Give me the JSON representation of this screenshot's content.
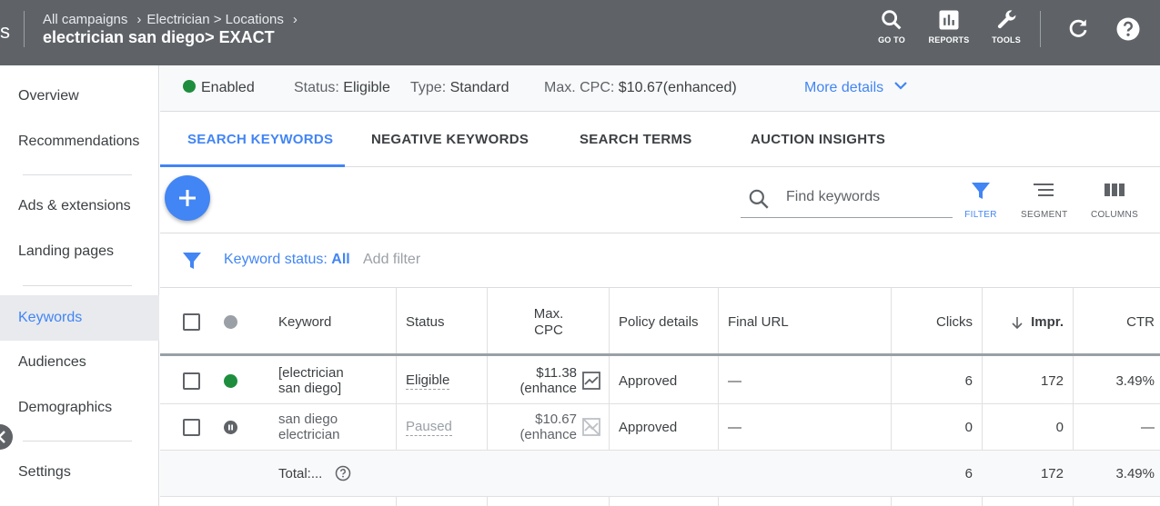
{
  "header": {
    "logo_fragment": "s",
    "breadcrumbs": [
      "All campaigns",
      "Electrician > Locations"
    ],
    "title": "electrician san diego> EXACT",
    "tools": [
      {
        "label": "GO TO",
        "icon": "search-icon"
      },
      {
        "label": "REPORTS",
        "icon": "bar-chart-icon"
      },
      {
        "label": "TOOLS",
        "icon": "wrench-icon"
      }
    ]
  },
  "sidebar": {
    "items": [
      {
        "label": "Overview"
      },
      {
        "label": "Recommendations"
      },
      {
        "label": "Ads & extensions"
      },
      {
        "label": "Landing pages"
      },
      {
        "label": "Keywords",
        "active": true
      },
      {
        "label": "Audiences"
      },
      {
        "label": "Demographics"
      },
      {
        "label": "Settings"
      }
    ]
  },
  "statusbar": {
    "enabled": "Enabled",
    "status_label": "Status:",
    "status_value": "Eligible",
    "type_label": "Type:",
    "type_value": "Standard",
    "maxcpc_label": "Max. CPC:",
    "maxcpc_value": "$10.67(enhanced)",
    "more_details": "More details"
  },
  "tabs": [
    "SEARCH KEYWORDS",
    "NEGATIVE KEYWORDS",
    "SEARCH TERMS",
    "AUCTION INSIGHTS"
  ],
  "toolbar": {
    "search_placeholder": "Find keywords",
    "filter_label": "FILTER",
    "segment_label": "SEGMENT",
    "columns_label": "COLUMNS"
  },
  "filter": {
    "label": "Keyword status:",
    "value": "All",
    "add_filter": "Add filter"
  },
  "table": {
    "headers": {
      "keyword": "Keyword",
      "status": "Status",
      "max_cpc_line1": "Max.",
      "max_cpc_line2": "CPC",
      "policy": "Policy details",
      "final_url": "Final URL",
      "clicks": "Clicks",
      "impr": "Impr.",
      "ctr": "CTR"
    },
    "rows": [
      {
        "keyword_line1": "[electrician",
        "keyword_line2": "san diego]",
        "status": "Eligible",
        "cpc_line1": "$11.38",
        "cpc_line2": "(enhance",
        "policy": "Approved",
        "final_url": "—",
        "clicks": "6",
        "impr": "172",
        "ctr": "3.49%"
      },
      {
        "keyword_line1": "san diego",
        "keyword_line2": "electrician",
        "status": "Paused",
        "cpc_line1": "$10.67",
        "cpc_line2": "(enhance",
        "policy": "Approved",
        "final_url": "—",
        "clicks": "0",
        "impr": "0",
        "ctr": "—"
      }
    ],
    "total": {
      "label": "Total:...",
      "clicks": "6",
      "impr": "172",
      "ctr": "3.49%"
    }
  },
  "colors": {
    "accent": "#4285f4",
    "header_bg": "#5f6368",
    "enabled_green": "#1e8e3e"
  }
}
